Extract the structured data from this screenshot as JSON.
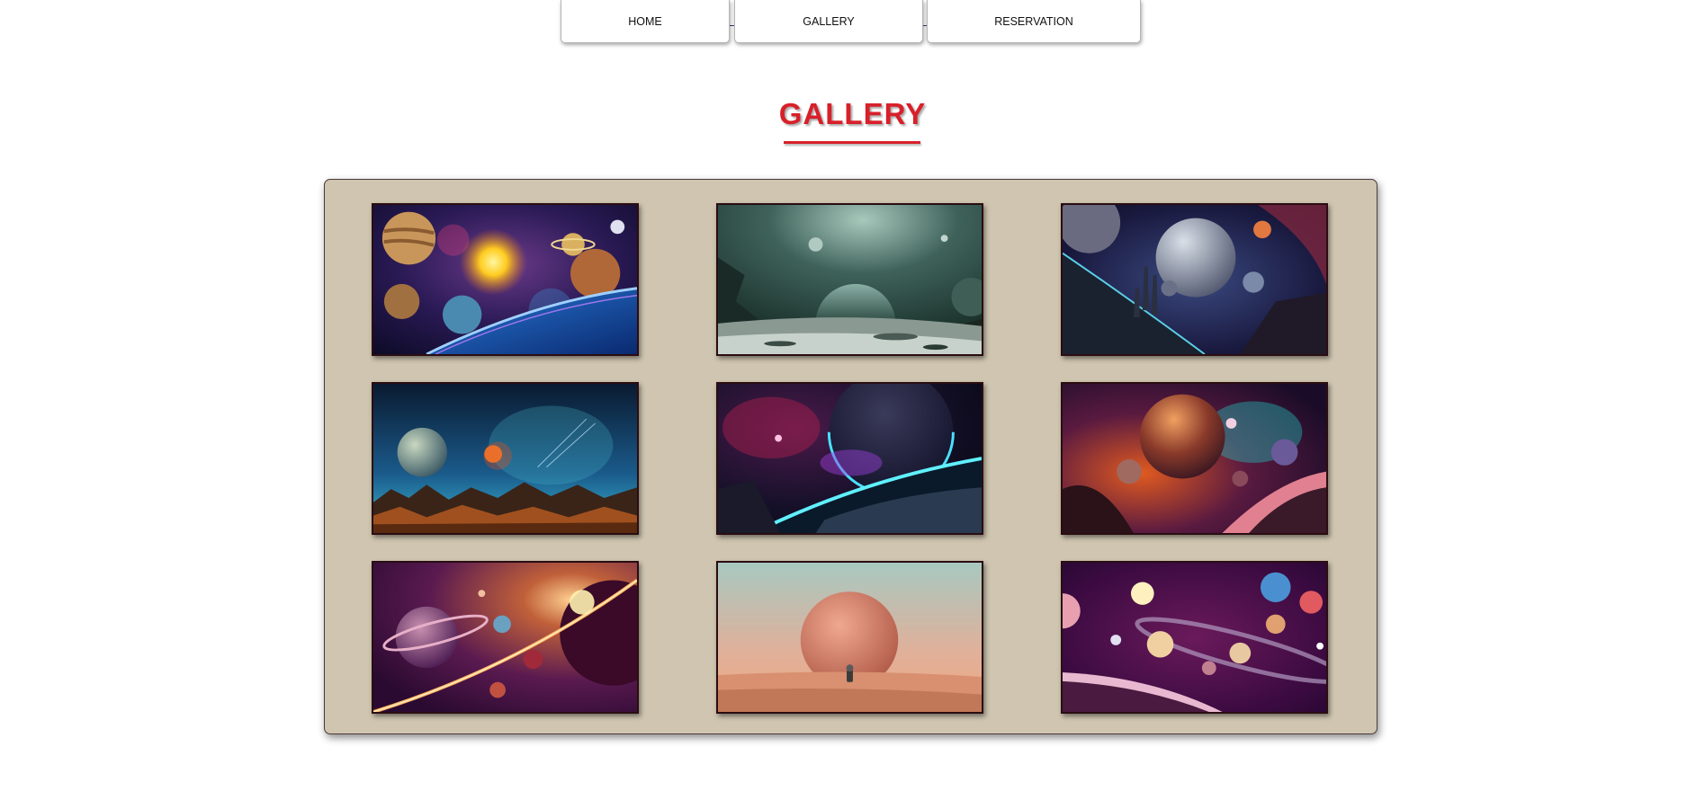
{
  "nav": {
    "items": [
      {
        "label": "HOME"
      },
      {
        "label": "GALLERY"
      },
      {
        "label": "RESERVATION"
      }
    ]
  },
  "page_title": "GALLERY",
  "gallery": {
    "images": [
      {
        "name": "solar-system-planets"
      },
      {
        "name": "green-moon-landscape"
      },
      {
        "name": "planets-over-city-ruins"
      },
      {
        "name": "blue-planet-over-mountains"
      },
      {
        "name": "cyan-glowing-planet"
      },
      {
        "name": "orange-nebula-planets"
      },
      {
        "name": "purple-ringed-planet"
      },
      {
        "name": "astronaut-desert-moon"
      },
      {
        "name": "purple-planets-ring"
      }
    ]
  }
}
